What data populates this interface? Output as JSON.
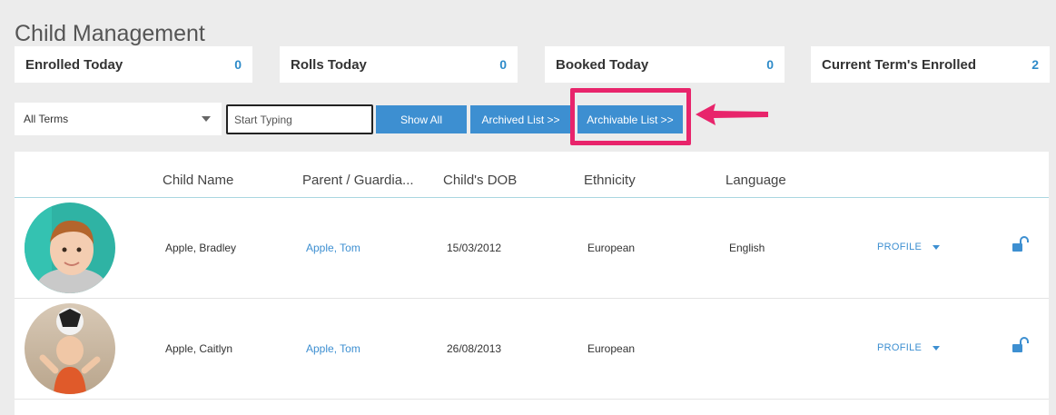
{
  "page": {
    "title": "Child Management"
  },
  "stats": [
    {
      "label": "Enrolled Today",
      "value": "0"
    },
    {
      "label": "Rolls Today",
      "value": "0"
    },
    {
      "label": "Booked Today",
      "value": "0"
    },
    {
      "label": "Current Term's Enrolled",
      "value": "2"
    }
  ],
  "filters": {
    "term_select": "All Terms",
    "search_placeholder": "Start Typing",
    "show_all": "Show All",
    "archived_list": "Archived List >>",
    "archivable_list": "Archivable List >>"
  },
  "table": {
    "columns": [
      "Child Name",
      "Parent / Guardia...",
      "Child's DOB",
      "Ethnicity",
      "Language"
    ],
    "rows": [
      {
        "child_name": "Apple, Bradley",
        "parent": "Apple, Tom",
        "dob": "15/03/2012",
        "ethnicity": "European",
        "language": "English",
        "action": "PROFILE"
      },
      {
        "child_name": "Apple, Caitlyn",
        "parent": "Apple, Tom",
        "dob": "26/08/2013",
        "ethnicity": "European",
        "language": "",
        "action": "PROFILE"
      }
    ]
  },
  "colors": {
    "accent": "#3d8fd1",
    "highlight": "#e8246b",
    "value_text": "#2e8bc9"
  },
  "icons": [
    "caret-down-icon",
    "unlock-icon",
    "pointer-arrow-icon"
  ]
}
